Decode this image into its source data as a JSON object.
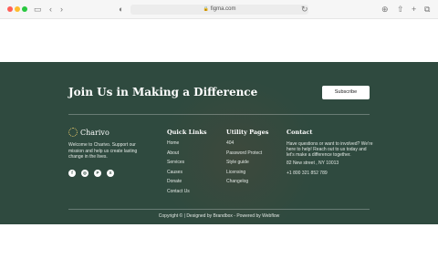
{
  "browser": {
    "url": "figma.com",
    "icons": [
      "sidebar-icon",
      "back-icon",
      "forward-icon",
      "shield-icon",
      "refresh-icon",
      "download-icon",
      "share-icon",
      "new-tab-icon",
      "tabs-icon"
    ]
  },
  "cta": {
    "title": "Join Us in Making a Difference",
    "button": "Subscribe"
  },
  "brand": {
    "name": "Charivo",
    "about": "Welcome to Charivo. Support our mission and help us create lasting change in the lives.",
    "socials": [
      "f",
      "◎",
      "P",
      "X"
    ]
  },
  "quick_links": {
    "title": "Quick Links",
    "items": [
      "Home",
      "About",
      "Services",
      "Causes",
      "Donate",
      "Contact Us"
    ]
  },
  "utility_pages": {
    "title": "Utility Pages",
    "items": [
      "404",
      "Password Protect",
      "Style guide",
      "Licensing",
      "Changelog"
    ]
  },
  "contact": {
    "title": "Contact",
    "text": "Have questions or want to involved? We're here to help! Reach out to us today and let's make a difference together.",
    "address": "82 New street , NY 10013",
    "phone": "+1 800 321 852 789"
  },
  "copyright": "Copyright © | Designed by Brandbox - Powered by Webflow",
  "colors": {
    "footer_bg": "#2f4a3f",
    "accent": "#e6c86a"
  }
}
